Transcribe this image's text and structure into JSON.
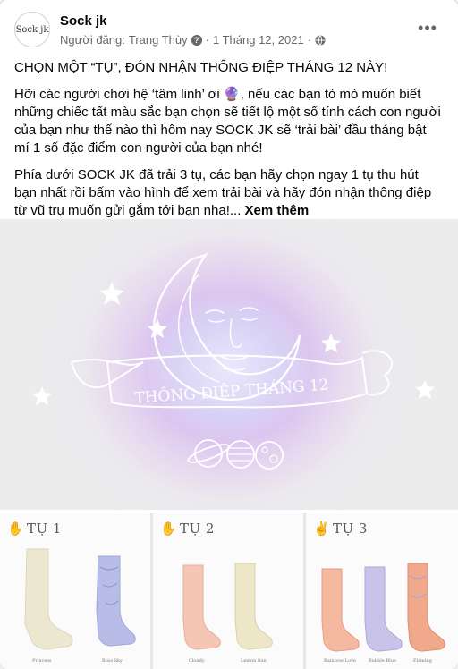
{
  "post": {
    "page_name": "Sock jk",
    "avatar_text": "Sock jk",
    "posted_by_label": "Người đăng:",
    "poster": "Trang Thùy",
    "poster_badge": "?",
    "separator": "·",
    "date": "1 Tháng 12, 2021",
    "separator2": "·",
    "audience_icon": "globe-icon",
    "more_label": "•••"
  },
  "body": {
    "headline": "CHỌN MỘT “TỤ”, ĐÓN NHẬN THÔNG ĐIỆP THÁNG 12 NÀY!",
    "p1_a": "Hỡi các người chơi hệ ‘tâm linh’ ơi",
    "p1_emoji": "🔮",
    "p1_b": ",  nếu các bạn tò mò muốn biết những chiếc tất màu sắc bạn chọn sẽ tiết lộ một số tính cách con người của bạn như thế nào thì hôm nay SOCK JK sẽ ‘trải bài’ đầu tháng bật mí 1 số đặc điểm con người của bạn nhé!",
    "p2": "Phía dưới SOCK JK đã trải 3 tụ, các bạn hãy chọn ngay 1 tụ thu hút bạn nhất rồi bấm vào hình để xem trải bài và hãy đón nhận thông điệp từ vũ trụ muốn gửi gắm tới bạn nha!... ",
    "see_more": "Xem thêm"
  },
  "hero": {
    "banner_text": "THÔNG ĐIỆP THÁNG 12"
  },
  "piles": [
    {
      "label": "TỤ 1",
      "hand": "✋",
      "captions": [
        "Princess",
        "Bliss Sky"
      ]
    },
    {
      "label": "TỤ 2",
      "hand": "✋",
      "captions": [
        "Cloudy",
        "Lemon Sun"
      ]
    },
    {
      "label": "TỤ 3",
      "hand": "✌",
      "captions": [
        "Rainbow Love",
        "Bubble Blue",
        "Flaming"
      ]
    }
  ],
  "colors": {
    "text": "#050505",
    "secondary": "#65676b",
    "moon_line": "#ffffff"
  }
}
